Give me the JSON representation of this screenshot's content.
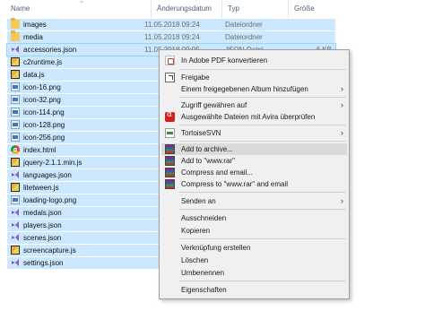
{
  "header": {
    "col_name": "Name",
    "col_date": "Änderungsdatum",
    "col_type": "Typ",
    "col_size": "Größe"
  },
  "files": [
    {
      "name": "images",
      "date": "11.05.2018 09:24",
      "type": "Dateiordner",
      "size": "",
      "icon": "folder-icon"
    },
    {
      "name": "media",
      "date": "11.05.2018 09:24",
      "type": "Dateiordner",
      "size": "",
      "icon": "folder-icon"
    },
    {
      "name": "accessories.json",
      "date": "11.05.2018 09:05",
      "type": "JSON-Datei",
      "size": "6 KB",
      "icon": "visual-studio-icon"
    },
    {
      "name": "c2runtime.js",
      "date": "",
      "type": "",
      "size": "",
      "icon": "js-file-icon"
    },
    {
      "name": "data.js",
      "date": "",
      "type": "",
      "size": "",
      "icon": "js-file-icon"
    },
    {
      "name": "icon-16.png",
      "date": "",
      "type": "",
      "size": "",
      "icon": "png-file-icon"
    },
    {
      "name": "icon-32.png",
      "date": "",
      "type": "",
      "size": "",
      "icon": "png-file-icon"
    },
    {
      "name": "icon-114.png",
      "date": "",
      "type": "",
      "size": "",
      "icon": "png-file-icon"
    },
    {
      "name": "icon-128.png",
      "date": "",
      "type": "",
      "size": "",
      "icon": "png-file-icon"
    },
    {
      "name": "icon-256.png",
      "date": "",
      "type": "",
      "size": "",
      "icon": "png-file-icon"
    },
    {
      "name": "index.html",
      "date": "",
      "type": "",
      "size": "",
      "icon": "chrome-icon"
    },
    {
      "name": "jquery-2.1.1.min.js",
      "date": "",
      "type": "",
      "size": "",
      "icon": "js-file-icon"
    },
    {
      "name": "languages.json",
      "date": "",
      "type": "",
      "size": "",
      "icon": "visual-studio-icon"
    },
    {
      "name": "litetween.js",
      "date": "",
      "type": "",
      "size": "",
      "icon": "js-file-icon"
    },
    {
      "name": "loading-logo.png",
      "date": "",
      "type": "",
      "size": "",
      "icon": "png-file-icon"
    },
    {
      "name": "medals.json",
      "date": "",
      "type": "",
      "size": "",
      "icon": "visual-studio-icon"
    },
    {
      "name": "players.json",
      "date": "",
      "type": "",
      "size": "",
      "icon": "visual-studio-icon"
    },
    {
      "name": "scenes.json",
      "date": "",
      "type": "",
      "size": "",
      "icon": "visual-studio-icon"
    },
    {
      "name": "screencapture.js",
      "date": "",
      "type": "",
      "size": "",
      "icon": "js-file-icon"
    },
    {
      "name": "settings.json",
      "date": "",
      "type": "",
      "size": "",
      "icon": "visual-studio-icon"
    }
  ],
  "context_menu": {
    "pdf": "In Adobe PDF konvertieren",
    "share": "Freigabe",
    "album": "Einem freigegebenen Album hinzufügen",
    "access": "Zugriff gewähren auf",
    "avira": "Ausgewählte Dateien mit Avira überprüfen",
    "svn": "TortoiseSVN",
    "add_archive": "Add to archive...",
    "add_rar": "Add to \"www.rar\"",
    "compress_email": "Compress and email...",
    "compress_rar_email": "Compress to \"www.rar\" and email",
    "send_to": "Senden an",
    "cut": "Ausschneiden",
    "copy": "Kopieren",
    "shortcut": "Verknüpfung erstellen",
    "delete": "Löschen",
    "rename": "Umbenennen",
    "properties": "Eigenschaften"
  },
  "colors": {
    "selection": "#cce8ff",
    "menu_bg": "#f0f0f0",
    "menu_highlight": "#dadada"
  }
}
